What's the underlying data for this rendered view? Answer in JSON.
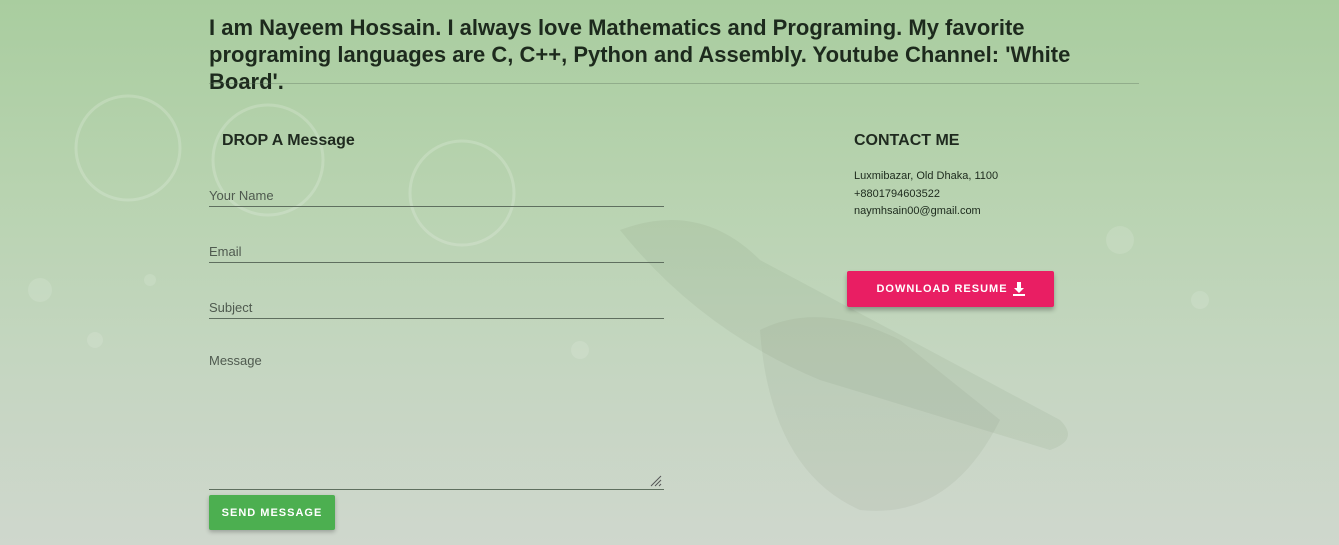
{
  "intro": "I am Nayeem Hossain. I always love Mathematics and Programing. My favorite programing languages are C, C++, Python and Assembly. Youtube Channel: 'White Board'.",
  "form": {
    "title": "DROP A Message",
    "name_placeholder": "Your Name",
    "email_placeholder": "Email",
    "subject_placeholder": "Subject",
    "message_placeholder": "Message",
    "send_label": "SEND MESSAGE"
  },
  "contact": {
    "title": "CONTACT ME",
    "address": "Luxmibazar, Old Dhaka, 1100",
    "phone": "+8801794603522",
    "email": "naymhsain00@gmail.com",
    "resume_label": "DOWNLOAD RESUME",
    "resume_icon": "download-icon"
  },
  "colors": {
    "send_button": "#4caf50",
    "resume_button": "#e91e63"
  }
}
